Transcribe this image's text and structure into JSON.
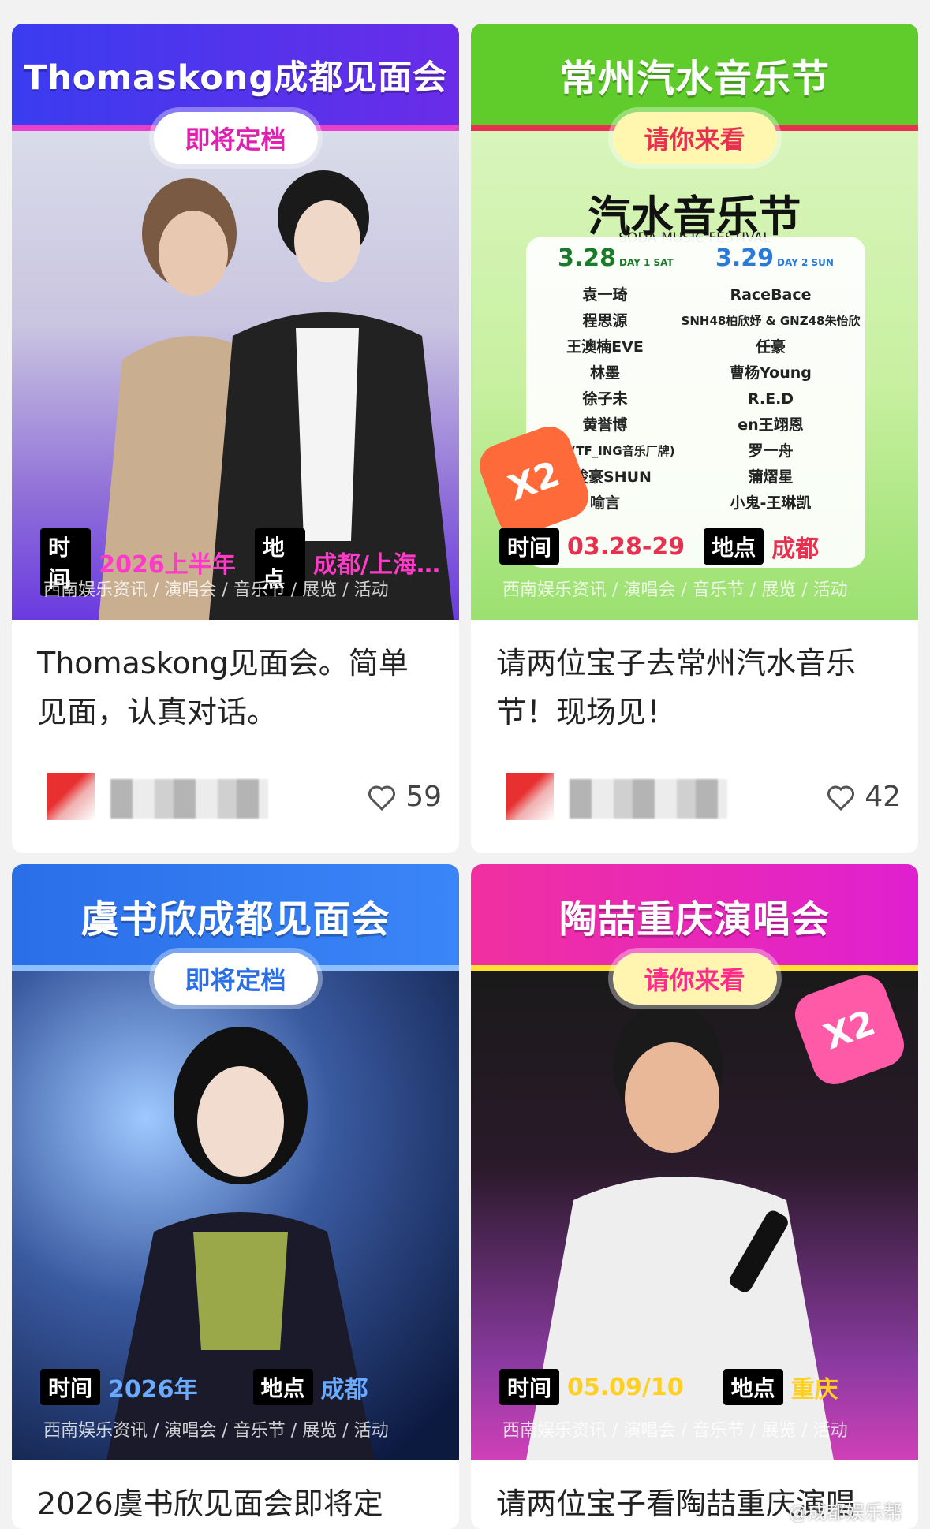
{
  "cards": [
    {
      "title": "Thomaskong成都见面会",
      "badge": "即将定档",
      "time_label": "时间",
      "time_value": "2026上半年",
      "place_label": "地点",
      "place_value": "成都/上海…",
      "footer": "西南娱乐资讯 / 演唱会 / 音乐节 / 展览 / 活动",
      "description": "Thomaskong见面会。简单见面，认真对话。",
      "likes": "59",
      "colors": {
        "bar": "#2f45f0",
        "accent": "#e840c8"
      }
    },
    {
      "title": "常州汽水音乐节",
      "badge": "请你来看",
      "festival_name": "汽水音乐节",
      "festival_sub": "SODA MUSIC FESTIVAL",
      "day1": "3.28",
      "day1_tag": "DAY 1 SAT",
      "day2": "3.29",
      "day2_tag": "DAY 2 SUN",
      "day1_artists": [
        "袁一琦",
        "程思源",
        "王澳楠EVE",
        "林墨",
        "徐子未",
        "黄誉博",
        "朱子墨(TF_ING音乐厂牌)",
        "张峻豪SHUN",
        "喻言"
      ],
      "day2_artists": [
        "RaceBace",
        "SNH48柏欣妤 & GNZ48朱怡欣",
        "任豪",
        "曹杨Young",
        "R.E.D",
        "en王翊恩",
        "罗一舟",
        "蒲熠星",
        "小鬼-王琳凯"
      ],
      "x2": "X2",
      "time_label": "时间",
      "time_value": "03.28-29",
      "place_label": "地点",
      "place_value": "成都",
      "footer": "西南娱乐资讯 / 演唱会 / 音乐节 / 展览 / 活动",
      "description": "请两位宝子去常州汽水音乐节！现场见！",
      "likes": "42",
      "colors": {
        "bar": "#5fcc2c",
        "accent": "#e83050"
      }
    },
    {
      "title": "虞书欣成都见面会",
      "badge": "即将定档",
      "time_label": "时间",
      "time_value": "2026年",
      "place_label": "地点",
      "place_value": "成都",
      "footer": "西南娱乐资讯 / 演唱会 / 音乐节 / 展览 / 活动",
      "description": "2026虞书欣见面会即将定",
      "colors": {
        "bar": "#2a6ee8",
        "accent": "#2a6ee8"
      }
    },
    {
      "title": "陶喆重庆演唱会",
      "badge": "请你来看",
      "x2": "X2",
      "time_label": "时间",
      "time_value": "05.09/10",
      "place_label": "地点",
      "place_value": "重庆",
      "footer": "西南娱乐资讯 / 演唱会 / 音乐节 / 展览 / 活动",
      "description": "请两位宝子看陶喆重庆演唱",
      "watermark": "@成都娱乐帮",
      "colors": {
        "bar": "#f030b0",
        "accent": "#ff8800"
      }
    }
  ]
}
